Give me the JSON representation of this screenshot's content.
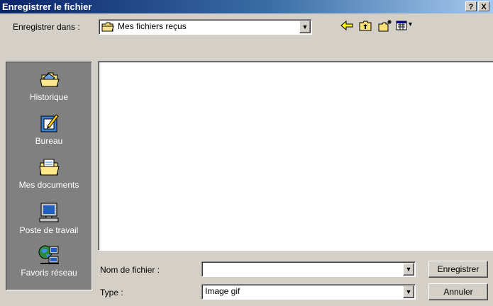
{
  "window": {
    "title": "Enregistrer le fichier",
    "help_glyph": "?",
    "close_glyph": "X"
  },
  "savein": {
    "label": "Enregistrer dans :",
    "value": "Mes fichiers reçus",
    "icon": "folder-icon"
  },
  "toolbar": {
    "icons": [
      "back-arrow-icon",
      "up-folder-icon",
      "new-folder-icon",
      "view-menu-icon"
    ],
    "view_arrow": "▾"
  },
  "places": [
    {
      "label": "Historique",
      "icon": "history-icon"
    },
    {
      "label": "Bureau",
      "icon": "desktop-icon"
    },
    {
      "label": "Mes documents",
      "icon": "my-documents-icon"
    },
    {
      "label": "Poste de travail",
      "icon": "my-computer-icon"
    },
    {
      "label": "Favoris réseau",
      "icon": "network-places-icon"
    }
  ],
  "filename": {
    "label": "Nom de fichier :",
    "value": ""
  },
  "filetype": {
    "label": "Type :",
    "value": "Image gif"
  },
  "buttons": {
    "save": "Enregistrer",
    "cancel": "Annuler"
  },
  "dropdown_glyph": "▼",
  "colors": {
    "titlebar_start": "#0a246a",
    "titlebar_end": "#a6caf0",
    "face": "#d4d0c8",
    "places_bg": "#808080"
  }
}
